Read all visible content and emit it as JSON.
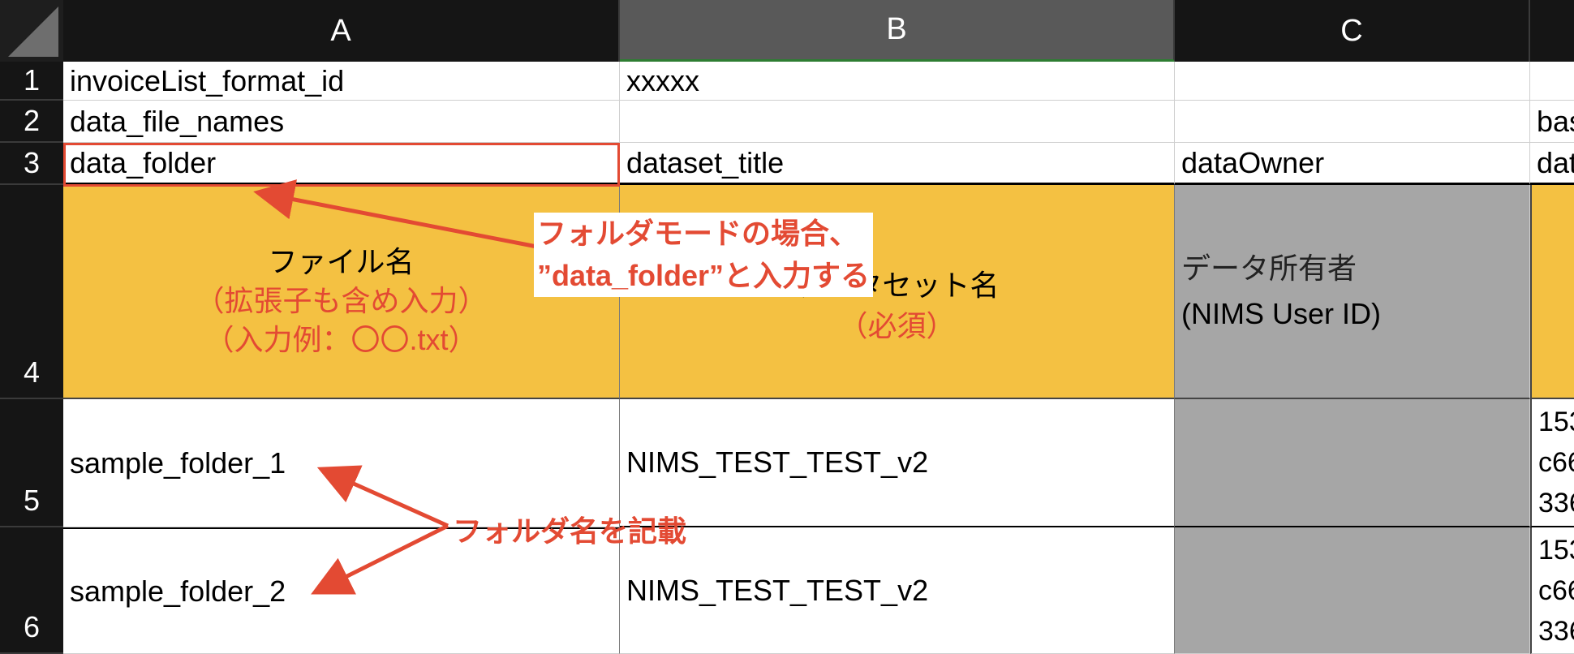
{
  "columns": [
    "A",
    "B",
    "C"
  ],
  "rows": [
    "1",
    "2",
    "3",
    "4",
    "5",
    "6"
  ],
  "cells": {
    "a1": "invoiceList_format_id",
    "b1": "xxxxx",
    "a2": "data_file_names",
    "d2": "bas",
    "a3": "data_folder",
    "b3": "dataset_title",
    "c3": "dataOwner",
    "d3": "dat",
    "a4_line1": "ファイル名",
    "a4_line2": "（拡張子も含め入力）",
    "a4_line3": "（入力例：〇〇.txt）",
    "b4_line1": "データセット名",
    "b4_line2": "（必須）",
    "c4_line1": "データ所有者",
    "c4_line2": "(NIMS User ID)",
    "a5": "sample_folder_1",
    "b5": "NIMS_TEST_TEST_v2",
    "d5_l1": "153",
    "d5_l2": "c66",
    "d5_l3": "336",
    "a6": "sample_folder_2",
    "b6": "NIMS_TEST_TEST_v2",
    "d6_l1": "153",
    "d6_l2": "c66",
    "d6_l3": "336"
  },
  "annotations": {
    "folder_mode_line1": "フォルダモードの場合、",
    "folder_mode_line2": "”data_folder”と入力する",
    "folder_name_note": "フォルダ名を記載"
  },
  "colors": {
    "header_bg": "#151515",
    "selected_header_bg": "#595959",
    "required_fill": "#f4c142",
    "optional_fill": "#a6a6a6",
    "annotation": "#e34a33"
  }
}
